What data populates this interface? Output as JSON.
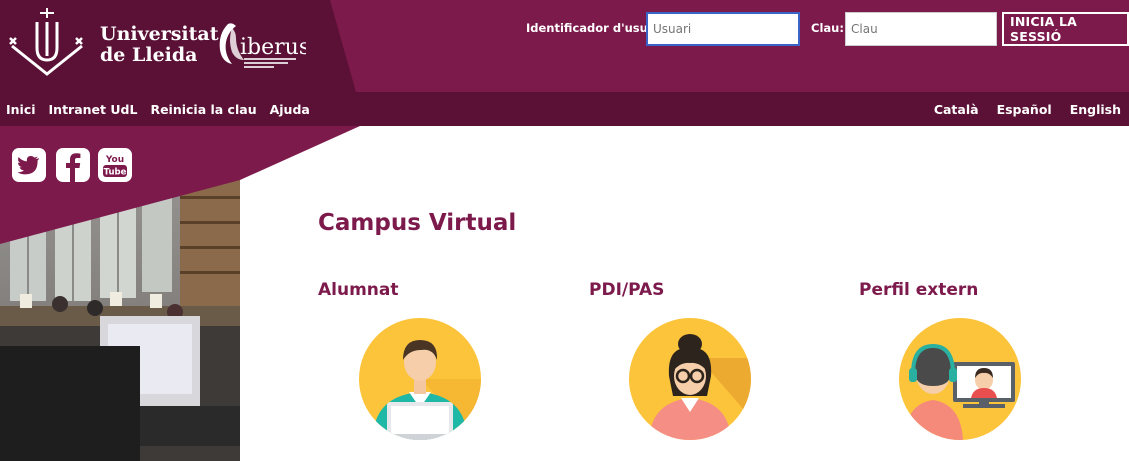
{
  "header": {
    "university_name_line1": "Universitat",
    "university_name_line2": "de Lleida"
  },
  "login": {
    "user_label": "Identificador d'usuari",
    "user_placeholder": "Usuari",
    "password_label": "Clau:",
    "password_placeholder": "Clau",
    "submit_label": "INICIA LA SESSIÓ"
  },
  "nav": {
    "left": [
      {
        "label": "Inici"
      },
      {
        "label": "Intranet UdL"
      },
      {
        "label": "Reinicia la clau"
      },
      {
        "label": "Ajuda"
      }
    ],
    "languages": [
      {
        "label": "Català"
      },
      {
        "label": "Español"
      },
      {
        "label": "English"
      }
    ]
  },
  "social": [
    {
      "icon": "twitter-icon"
    },
    {
      "icon": "facebook-icon"
    },
    {
      "icon": "youtube-icon",
      "text_line1": "You",
      "text_line2": "Tube"
    }
  ],
  "main": {
    "title": "Campus Virtual",
    "profiles": [
      {
        "title": "Alumnat",
        "icon": "student-avatar-icon"
      },
      {
        "title": "PDI/PAS",
        "icon": "staff-avatar-icon"
      },
      {
        "title": "Perfil extern",
        "icon": "external-user-avatar-icon"
      }
    ]
  },
  "colors": {
    "brand_purple": "#7d1a4c",
    "brand_dark_purple": "#5b1136",
    "avatar_yellow": "#fcc43a"
  }
}
